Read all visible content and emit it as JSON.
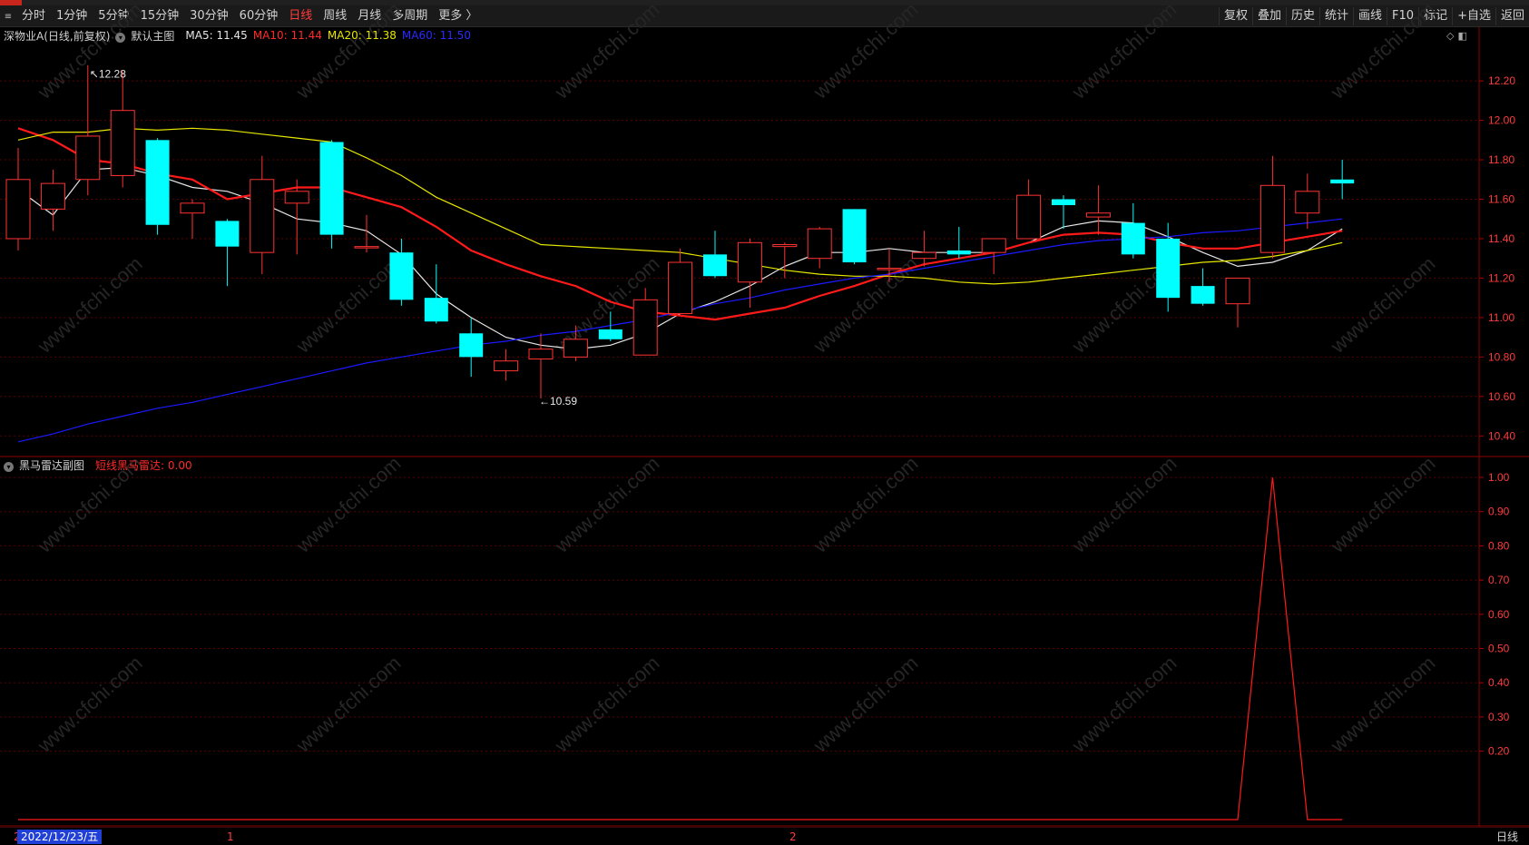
{
  "toolbar": {
    "periods": [
      {
        "label": "分时",
        "active": false
      },
      {
        "label": "1分钟",
        "active": false
      },
      {
        "label": "5分钟",
        "active": false
      },
      {
        "label": "15分钟",
        "active": false
      },
      {
        "label": "30分钟",
        "active": false
      },
      {
        "label": "60分钟",
        "active": false
      },
      {
        "label": "日线",
        "active": true
      },
      {
        "label": "周线",
        "active": false
      },
      {
        "label": "月线",
        "active": false
      },
      {
        "label": "多周期",
        "active": false
      },
      {
        "label": "更多 〉",
        "active": false
      }
    ],
    "tools": [
      "复权",
      "叠加",
      "历史",
      "统计",
      "画线",
      "F10",
      "标记",
      "+自选",
      "返回"
    ]
  },
  "main_legend": {
    "title": "深物业A(日线,前复权)",
    "chart_label": "默认主图",
    "ma5": "MA5: 11.45",
    "ma10": "MA10: 11.44",
    "ma20": "MA20: 11.38",
    "ma60": "MA60: 11.50"
  },
  "sub_legend": {
    "title": "黑马雷达副图",
    "indicator": "短线黑马雷达: 0.00"
  },
  "annotations": {
    "high": "12.28",
    "low": "10.59"
  },
  "bottom": {
    "date": "2022/12/23/五",
    "mark1": "1",
    "mark2": "2",
    "period": "日线"
  },
  "watermark": "www.cfchi.com",
  "colors": {
    "up": "#ff3232",
    "down": "#00ffff",
    "ma5": "#e6e6e6",
    "ma10": "#ff1a1a",
    "ma20": "#e6e600",
    "ma60": "#1a1aff",
    "grid": "#5a0000"
  },
  "chart_data": [
    {
      "type": "candlestick",
      "title": "深物业A(日线,前复权)",
      "y_ticks": [
        12.2,
        12.0,
        11.8,
        11.6,
        11.4,
        11.2,
        11.0,
        10.8,
        10.6,
        10.4
      ],
      "ylim": [
        10.3,
        12.38
      ],
      "candles": [
        {
          "o": 11.4,
          "c": 11.7,
          "h": 11.86,
          "l": 11.34
        },
        {
          "o": 11.55,
          "c": 11.68,
          "h": 11.75,
          "l": 11.44
        },
        {
          "o": 11.7,
          "c": 11.92,
          "h": 12.28,
          "l": 11.62
        },
        {
          "o": 11.72,
          "c": 12.05,
          "h": 12.25,
          "l": 11.66
        },
        {
          "o": 11.9,
          "c": 11.47,
          "h": 11.91,
          "l": 11.42
        },
        {
          "o": 11.53,
          "c": 11.58,
          "h": 11.6,
          "l": 11.4
        },
        {
          "o": 11.49,
          "c": 11.36,
          "h": 11.5,
          "l": 11.16
        },
        {
          "o": 11.33,
          "c": 11.7,
          "h": 11.82,
          "l": 11.22
        },
        {
          "o": 11.58,
          "c": 11.64,
          "h": 11.7,
          "l": 11.32
        },
        {
          "o": 11.89,
          "c": 11.42,
          "h": 11.9,
          "l": 11.35
        },
        {
          "o": 11.36,
          "c": 11.36,
          "h": 11.52,
          "l": 11.33
        },
        {
          "o": 11.33,
          "c": 11.09,
          "h": 11.4,
          "l": 11.06
        },
        {
          "o": 11.1,
          "c": 10.98,
          "h": 11.27,
          "l": 10.97
        },
        {
          "o": 10.92,
          "c": 10.8,
          "h": 11.0,
          "l": 10.7
        },
        {
          "o": 10.73,
          "c": 10.78,
          "h": 10.84,
          "l": 10.68
        },
        {
          "o": 10.79,
          "c": 10.84,
          "h": 10.92,
          "l": 10.59
        },
        {
          "o": 10.8,
          "c": 10.89,
          "h": 10.96,
          "l": 10.78
        },
        {
          "o": 10.94,
          "c": 10.89,
          "h": 11.03,
          "l": 10.88
        },
        {
          "o": 10.81,
          "c": 11.09,
          "h": 11.15,
          "l": 10.81
        },
        {
          "o": 11.02,
          "c": 11.28,
          "h": 11.35,
          "l": 11.02
        },
        {
          "o": 11.32,
          "c": 11.21,
          "h": 11.44,
          "l": 11.2
        },
        {
          "o": 11.18,
          "c": 11.38,
          "h": 11.4,
          "l": 11.05
        },
        {
          "o": 11.36,
          "c": 11.37,
          "h": 11.38,
          "l": 11.2
        },
        {
          "o": 11.3,
          "c": 11.45,
          "h": 11.46,
          "l": 11.25
        },
        {
          "o": 11.55,
          "c": 11.28,
          "h": 11.55,
          "l": 11.27
        },
        {
          "o": 11.25,
          "c": 11.25,
          "h": 11.35,
          "l": 11.18
        },
        {
          "o": 11.3,
          "c": 11.33,
          "h": 11.44,
          "l": 11.26
        },
        {
          "o": 11.34,
          "c": 11.32,
          "h": 11.46,
          "l": 11.3
        },
        {
          "o": 11.33,
          "c": 11.4,
          "h": 11.4,
          "l": 11.22
        },
        {
          "o": 11.4,
          "c": 11.62,
          "h": 11.7,
          "l": 11.4
        },
        {
          "o": 11.6,
          "c": 11.57,
          "h": 11.62,
          "l": 11.45
        },
        {
          "o": 11.51,
          "c": 11.53,
          "h": 11.67,
          "l": 11.42
        },
        {
          "o": 11.48,
          "c": 11.32,
          "h": 11.58,
          "l": 11.3
        },
        {
          "o": 11.4,
          "c": 11.1,
          "h": 11.48,
          "l": 11.03
        },
        {
          "o": 11.16,
          "c": 11.07,
          "h": 11.25,
          "l": 11.06
        },
        {
          "o": 11.07,
          "c": 11.2,
          "h": 11.2,
          "l": 10.95
        },
        {
          "o": 11.33,
          "c": 11.67,
          "h": 11.82,
          "l": 11.3
        },
        {
          "o": 11.53,
          "c": 11.64,
          "h": 11.73,
          "l": 11.45
        },
        {
          "o": 11.7,
          "c": 11.68,
          "h": 11.8,
          "l": 11.6
        }
      ],
      "ma_lines": [
        {
          "name": "MA5",
          "values": [
            11.65,
            11.52,
            11.75,
            11.76,
            11.72,
            11.66,
            11.64,
            11.58,
            11.5,
            11.48,
            11.44,
            11.32,
            11.12,
            11.0,
            10.9,
            10.86,
            10.84,
            10.86,
            10.92,
            11.02,
            11.08,
            11.16,
            11.26,
            11.33,
            11.33,
            11.35,
            11.33,
            11.33,
            11.33,
            11.38,
            11.46,
            11.49,
            11.48,
            11.41,
            11.33,
            11.26,
            11.28,
            11.34,
            11.45
          ]
        },
        {
          "name": "MA10",
          "values": [
            11.96,
            11.9,
            11.8,
            11.78,
            11.73,
            11.7,
            11.6,
            11.63,
            11.66,
            11.66,
            11.61,
            11.56,
            11.46,
            11.34,
            11.27,
            11.21,
            11.16,
            11.08,
            11.03,
            11.01,
            10.99,
            11.02,
            11.05,
            11.11,
            11.16,
            11.22,
            11.27,
            11.3,
            11.33,
            11.38,
            11.42,
            11.43,
            11.42,
            11.38,
            11.35,
            11.35,
            11.38,
            11.41,
            11.44
          ]
        },
        {
          "name": "MA20",
          "values": [
            11.9,
            11.94,
            11.94,
            11.96,
            11.95,
            11.96,
            11.95,
            11.93,
            11.91,
            11.89,
            11.81,
            11.72,
            11.61,
            11.53,
            11.45,
            11.37,
            11.36,
            11.35,
            11.34,
            11.33,
            11.3,
            11.27,
            11.24,
            11.22,
            11.21,
            11.21,
            11.2,
            11.18,
            11.17,
            11.18,
            11.2,
            11.22,
            11.24,
            11.26,
            11.28,
            11.29,
            11.31,
            11.34,
            11.38
          ]
        },
        {
          "name": "MA60",
          "values": [
            10.37,
            10.41,
            10.46,
            10.5,
            10.54,
            10.57,
            10.61,
            10.65,
            10.69,
            10.73,
            10.77,
            10.8,
            10.83,
            10.86,
            10.88,
            10.91,
            10.93,
            10.96,
            10.99,
            11.03,
            11.07,
            11.1,
            11.14,
            11.17,
            11.2,
            11.22,
            11.25,
            11.28,
            11.31,
            11.34,
            11.37,
            11.39,
            11.4,
            11.41,
            11.43,
            11.44,
            11.46,
            11.48,
            11.5
          ]
        }
      ]
    },
    {
      "type": "line",
      "title": "黑马雷达副图",
      "series": [
        {
          "name": "短线黑马雷达",
          "values": [
            0,
            0,
            0,
            0,
            0,
            0,
            0,
            0,
            0,
            0,
            0,
            0,
            0,
            0,
            0,
            0,
            0,
            0,
            0,
            0,
            0,
            0,
            0,
            0,
            0,
            0,
            0,
            0,
            0,
            0,
            0,
            0,
            0,
            0,
            0,
            0,
            1,
            0,
            0
          ]
        }
      ],
      "y_ticks": [
        1.0,
        0.9,
        0.8,
        0.7,
        0.6,
        0.5,
        0.4,
        0.3,
        0.2
      ],
      "ylim": [
        0,
        1.0
      ]
    }
  ]
}
